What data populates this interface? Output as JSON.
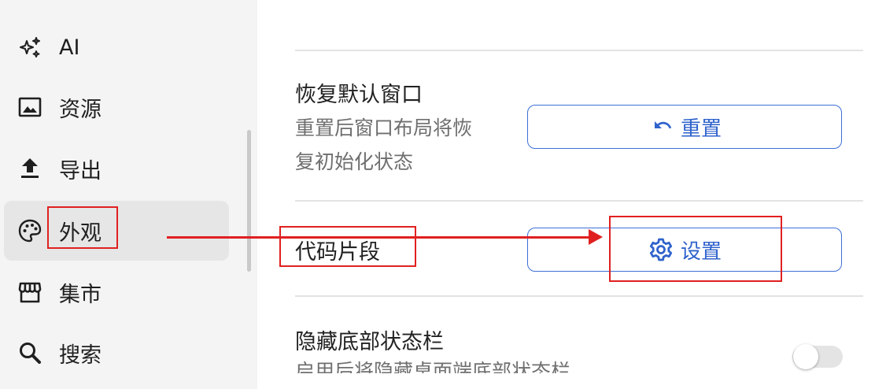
{
  "sidebar": {
    "items": [
      {
        "label": "AI",
        "icon": "sparkle-icon"
      },
      {
        "label": "资源",
        "icon": "image-icon"
      },
      {
        "label": "导出",
        "icon": "upload-icon"
      },
      {
        "label": "外观",
        "icon": "palette-icon",
        "active": true
      },
      {
        "label": "集市",
        "icon": "store-icon"
      },
      {
        "label": "搜索",
        "icon": "search-icon"
      }
    ]
  },
  "settings": {
    "reset_window": {
      "title": "恢复默认窗口",
      "desc_line1": "重置后窗口布局将恢",
      "desc_line2": "复初始化状态",
      "button_label": "重置"
    },
    "code_snippets": {
      "title": "代码片段",
      "button_label": "设置"
    },
    "hide_status_bar": {
      "title": "隐藏底部状态栏",
      "desc_partial": "启用后将隐藏桌面端底部状态栏",
      "enabled": false
    }
  },
  "colors": {
    "accent": "#2f63cc",
    "annotation": "#e02020"
  }
}
